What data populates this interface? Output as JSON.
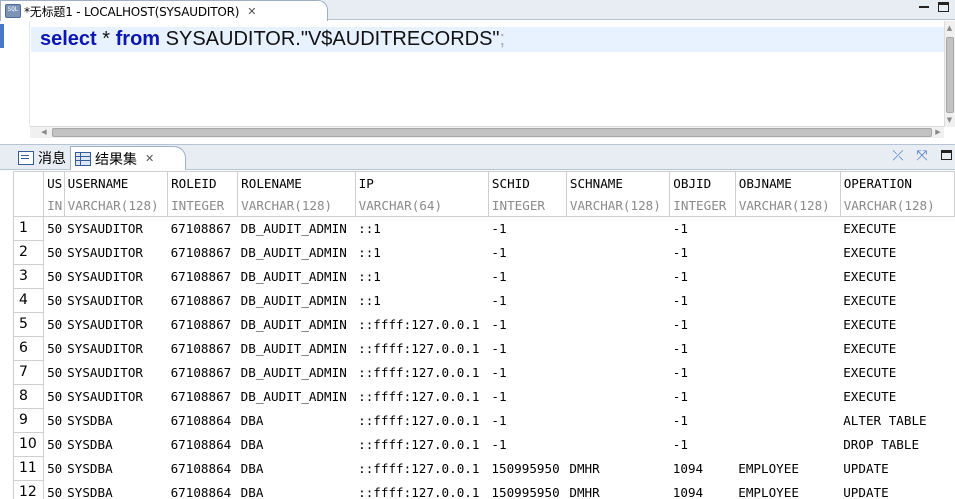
{
  "editor": {
    "tab_title": "*无标题1 - LOCALHOST(SYSAUDITOR)",
    "file_icon_text": "SQL",
    "close_glyph": "✕",
    "sql": {
      "kw_select": "select",
      "star": " * ",
      "kw_from": "from",
      "object": " SYSAUDITOR.\"V$AUDITRECORDS\"",
      "terminator": ";"
    }
  },
  "results": {
    "tabs": {
      "messages": "消息",
      "result_set": "结果集"
    },
    "close_glyph": "✕",
    "columns": [
      {
        "name": "US",
        "type": "IN"
      },
      {
        "name": "USERNAME",
        "type": "VARCHAR(128)"
      },
      {
        "name": "ROLEID",
        "type": "INTEGER"
      },
      {
        "name": "ROLENAME",
        "type": "VARCHAR(128)"
      },
      {
        "name": "IP",
        "type": "VARCHAR(64)"
      },
      {
        "name": "SCHID",
        "type": "INTEGER"
      },
      {
        "name": "SCHNAME",
        "type": "VARCHAR(128)"
      },
      {
        "name": "OBJID",
        "type": "INTEGER"
      },
      {
        "name": "OBJNAME",
        "type": "VARCHAR(128)"
      },
      {
        "name": "OPERATION",
        "type": "VARCHAR(128)"
      }
    ],
    "rows": [
      {
        "n": "1",
        "cells": [
          "50",
          "SYSAUDITOR",
          "67108867",
          "DB_AUDIT_ADMIN",
          "::1",
          "-1",
          "",
          "-1",
          "",
          "EXECUTE"
        ]
      },
      {
        "n": "2",
        "cells": [
          "50",
          "SYSAUDITOR",
          "67108867",
          "DB_AUDIT_ADMIN",
          "::1",
          "-1",
          "",
          "-1",
          "",
          "EXECUTE"
        ]
      },
      {
        "n": "3",
        "cells": [
          "50",
          "SYSAUDITOR",
          "67108867",
          "DB_AUDIT_ADMIN",
          "::1",
          "-1",
          "",
          "-1",
          "",
          "EXECUTE"
        ]
      },
      {
        "n": "4",
        "cells": [
          "50",
          "SYSAUDITOR",
          "67108867",
          "DB_AUDIT_ADMIN",
          "::1",
          "-1",
          "",
          "-1",
          "",
          "EXECUTE"
        ]
      },
      {
        "n": "5",
        "cells": [
          "50",
          "SYSAUDITOR",
          "67108867",
          "DB_AUDIT_ADMIN",
          "::ffff:127.0.0.1",
          "-1",
          "",
          "-1",
          "",
          "EXECUTE"
        ]
      },
      {
        "n": "6",
        "cells": [
          "50",
          "SYSAUDITOR",
          "67108867",
          "DB_AUDIT_ADMIN",
          "::ffff:127.0.0.1",
          "-1",
          "",
          "-1",
          "",
          "EXECUTE"
        ]
      },
      {
        "n": "7",
        "cells": [
          "50",
          "SYSAUDITOR",
          "67108867",
          "DB_AUDIT_ADMIN",
          "::ffff:127.0.0.1",
          "-1",
          "",
          "-1",
          "",
          "EXECUTE"
        ]
      },
      {
        "n": "8",
        "cells": [
          "50",
          "SYSAUDITOR",
          "67108867",
          "DB_AUDIT_ADMIN",
          "::ffff:127.0.0.1",
          "-1",
          "",
          "-1",
          "",
          "EXECUTE"
        ]
      },
      {
        "n": "9",
        "cells": [
          "50",
          "SYSDBA",
          "67108864",
          "DBA",
          "::ffff:127.0.0.1",
          "-1",
          "",
          "-1",
          "",
          "ALTER TABLE"
        ]
      },
      {
        "n": "10",
        "cells": [
          "50",
          "SYSDBA",
          "67108864",
          "DBA",
          "::ffff:127.0.0.1",
          "-1",
          "",
          "-1",
          "",
          "DROP TABLE"
        ]
      },
      {
        "n": "11",
        "cells": [
          "50",
          "SYSDBA",
          "67108864",
          "DBA",
          "::ffff:127.0.0.1",
          "150995950",
          "DMHR",
          "1094",
          "EMPLOYEE",
          "UPDATE"
        ]
      },
      {
        "n": "12",
        "cells": [
          "50",
          "SYSDBA",
          "67108864",
          "DBA",
          "::ffff:127.0.0.1",
          "150995950",
          "DMHR",
          "1094",
          "EMPLOYEE",
          "UPDATE"
        ]
      }
    ]
  }
}
